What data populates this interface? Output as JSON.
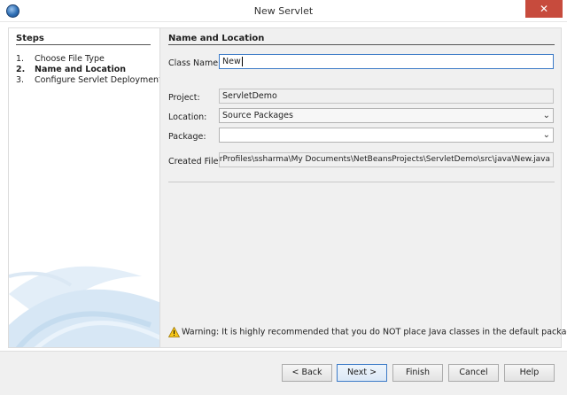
{
  "window": {
    "title": "New Servlet",
    "close_glyph": "✕"
  },
  "steps": {
    "heading": "Steps",
    "items": [
      {
        "num": "1.",
        "label": "Choose File Type"
      },
      {
        "num": "2.",
        "label": "Name and Location"
      },
      {
        "num": "3.",
        "label": "Configure Servlet Deployment"
      }
    ]
  },
  "main": {
    "heading": "Name and Location",
    "class_name": {
      "label": "Class Name:",
      "value": "New"
    },
    "project": {
      "label": "Project:",
      "value": "ServletDemo"
    },
    "location": {
      "label": "Location:",
      "value": "Source Packages"
    },
    "package": {
      "label": "Package:",
      "value": ""
    },
    "created_file": {
      "label": "Created File:",
      "value": "\\UserProfiles\\ssharma\\My Documents\\NetBeansProjects\\ServletDemo\\src\\java\\New.java"
    },
    "warning": "Warning: It is highly recommended that you do NOT place Java classes in the default package."
  },
  "buttons": {
    "back": "< Back",
    "next": "Next >",
    "finish": "Finish",
    "cancel": "Cancel",
    "help": "Help"
  },
  "icons": {
    "combo_arrow": "⌄",
    "warning": "warning-icon",
    "app": "netbeans-icon"
  },
  "colors": {
    "close": "#c74b3d",
    "focus_border": "#3d7bc7",
    "panel_bg": "#f0f0f0"
  }
}
